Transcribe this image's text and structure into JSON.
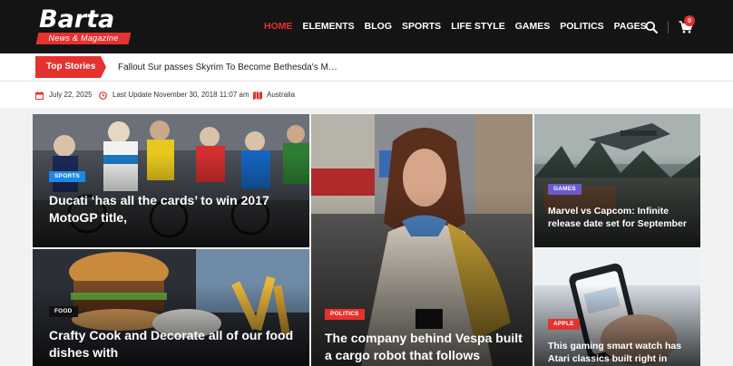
{
  "brand": {
    "name": "Barta",
    "tagline": "News & Magazine"
  },
  "nav": [
    {
      "label": "HOME",
      "active": true
    },
    {
      "label": "ELEMENTS",
      "active": false
    },
    {
      "label": "BLOG",
      "active": false
    },
    {
      "label": "SPORTS",
      "active": false
    },
    {
      "label": "LIFE STYLE",
      "active": false
    },
    {
      "label": "GAMES",
      "active": false
    },
    {
      "label": "POLITICS",
      "active": false
    },
    {
      "label": "PAGES",
      "active": false
    }
  ],
  "header_icons": {
    "search": "search-icon",
    "cart": "cart-icon",
    "cart_count": "0"
  },
  "ticker": {
    "label": "Top Stories",
    "headline": "Fallout Sur passes Skyrim To Become Bethesda's Most Sold Game"
  },
  "meta": {
    "date": "July 22, 2025",
    "last_update": "Last Update November 30, 2018 11:07 am",
    "location": "Australia"
  },
  "colors": {
    "accent": "#e5322e",
    "header_bg": "#141414",
    "sports": "#1e88e5",
    "games": "#6a5acd",
    "politics": "#e5322e",
    "apple": "#e5322e",
    "food": "#111111"
  },
  "cards": {
    "sports": {
      "category": "SPORTS",
      "title": "Ducati ‘has all the cards’ to win 2017 MotoGP title,"
    },
    "food": {
      "category": "FOOD",
      "title": "Crafty Cook and Decorate all of our food dishes with"
    },
    "politics": {
      "category": "POLITICS",
      "title": "The company behind Vespa built a cargo robot that follows"
    },
    "games": {
      "category": "GAMES",
      "title": "Marvel vs Capcom: Infinite release date set for September"
    },
    "apple": {
      "category": "APPLE",
      "title": "This gaming smart watch has Atari classics built right in"
    }
  }
}
